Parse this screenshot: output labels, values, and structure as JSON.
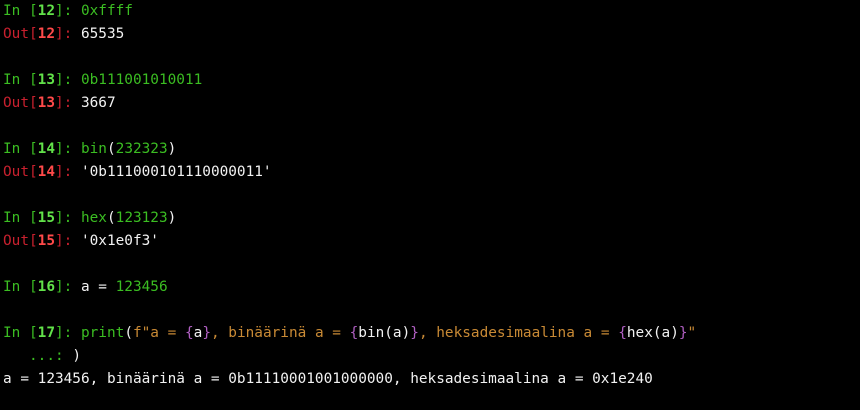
{
  "colors": {
    "background": "#000000",
    "prompt_in": "#3bbd22",
    "prompt_in_number": "#62e24a",
    "prompt_out": "#c8202e",
    "prompt_out_number": "#ff4a4a",
    "number_literal": "#3bbd22",
    "builtin": "#3bbd22",
    "string": "#c98a35",
    "fstring_brace": "#b05fc2",
    "text": "#f2f2f2"
  },
  "prompts": {
    "in_word": "In [",
    "out_word": "Out[",
    "close": "]: ",
    "continuation": "   ...: "
  },
  "cells": [
    {
      "n": "12",
      "input": "0xffff",
      "output": "65535"
    },
    {
      "n": "13",
      "input": "0b111001010011",
      "output": "3667"
    },
    {
      "n": "14",
      "input_fn": "bin",
      "input_arg": "232323",
      "output": "'0b111000101110000011'"
    },
    {
      "n": "15",
      "input_fn": "hex",
      "input_arg": "123123",
      "output": "'0x1e0f3'"
    },
    {
      "n": "16",
      "input_lhs": "a = ",
      "input_num": "123456"
    },
    {
      "n": "17",
      "print_fn": "print",
      "open_paren": "(",
      "fstring_prefix": "f\"a = ",
      "brace_open": "{",
      "var_a": "a",
      "brace_close": "}",
      "mid1": ", binäärinä a = ",
      "bin_call": "bin(a)",
      "mid2": ", heksadesimaalina a = ",
      "hex_call": "hex(a)",
      "string_end": "\"",
      "continuation_rest": ")",
      "stdout": "a = 123456, binäärinä a = 0b11110001001000000, heksadesimaalina a = 0x1e240"
    }
  ]
}
